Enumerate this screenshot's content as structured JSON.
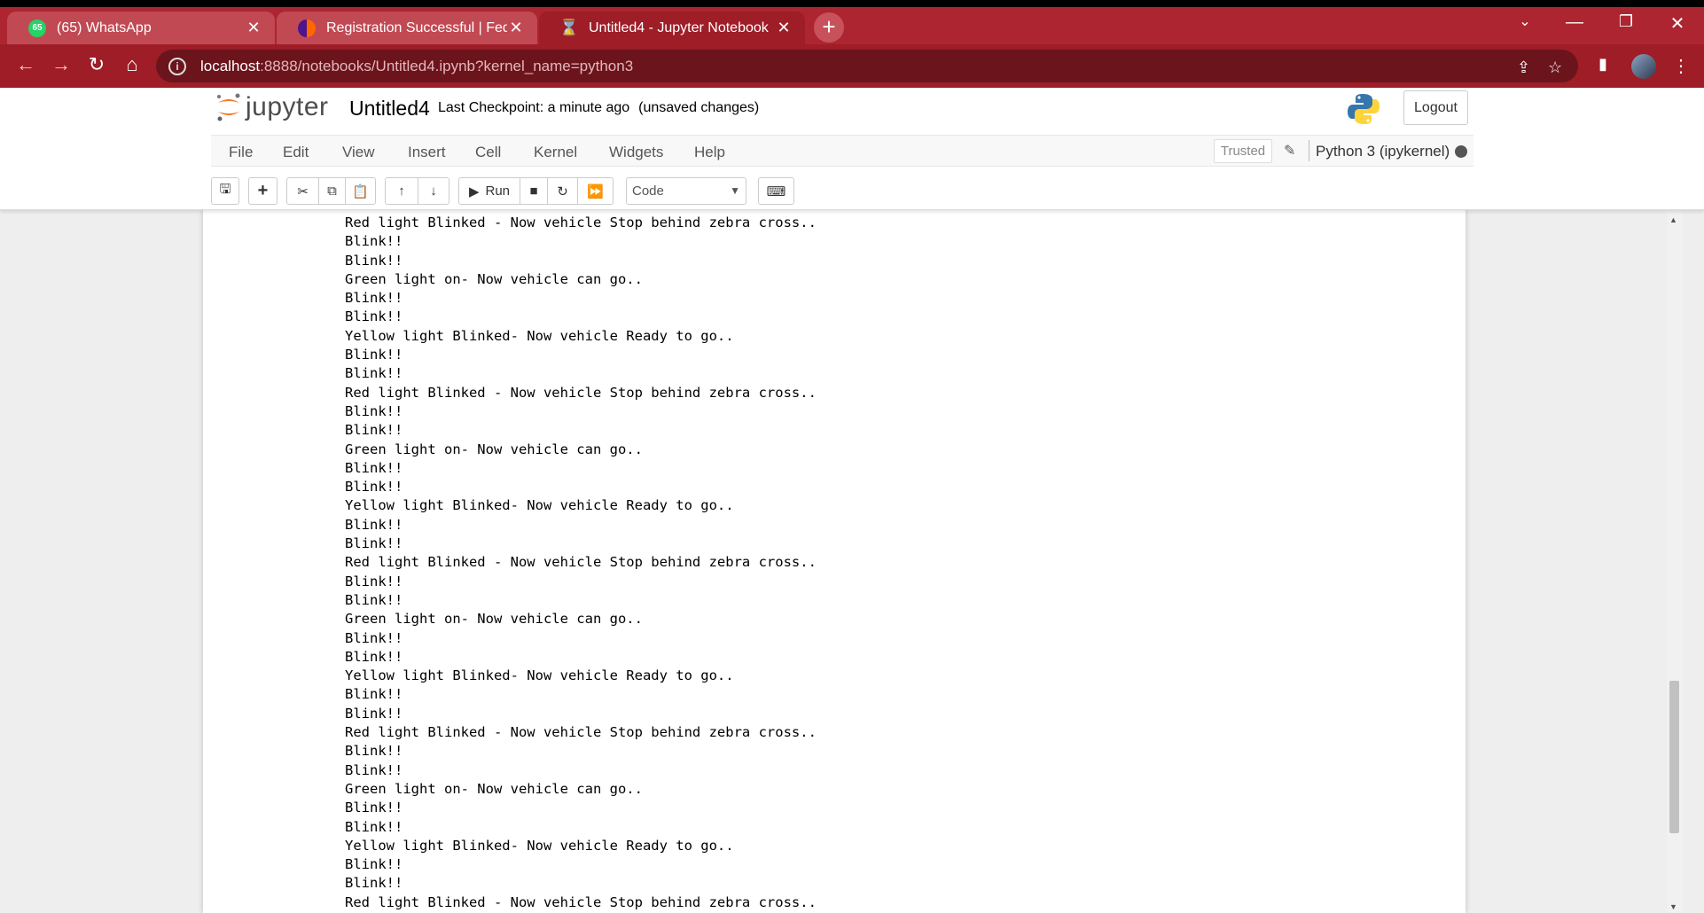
{
  "browser": {
    "tabs": [
      {
        "title": "(65) WhatsApp",
        "badge": "65",
        "favicon": "whatsapp-icon",
        "color": "#25d366",
        "active": false
      },
      {
        "title": "Registration Successful | FedEx In",
        "favicon": "fedex-icon",
        "color": "#4d148c",
        "active": false
      },
      {
        "title": "Untitled4 - Jupyter Notebook",
        "favicon": "hourglass-icon",
        "color": "#f37726",
        "active": true
      }
    ],
    "new_tab": "+",
    "url_host": "localhost",
    "url_path": ":8888/notebooks/Untitled4.ipynb?kernel_name=python3",
    "theme_color": "#ad2530"
  },
  "jupyter": {
    "logo_text": "jupyter",
    "notebook_title": "Untitled4",
    "checkpoint": "Last Checkpoint: a minute ago",
    "unsaved": "(unsaved changes)",
    "logout": "Logout",
    "menu": [
      "File",
      "Edit",
      "View",
      "Insert",
      "Cell",
      "Kernel",
      "Widgets",
      "Help"
    ],
    "trusted": "Trusted",
    "kernel": "Python 3 (ipykernel)",
    "run_label": "Run",
    "cell_type": "Code"
  },
  "output_lines": [
    "Red light Blinked - Now vehicle Stop behind zebra cross..",
    "Blink!!",
    "Blink!!",
    "Green light on- Now vehicle can go..",
    "Blink!!",
    "Blink!!",
    "Yellow light Blinked- Now vehicle Ready to go..",
    "Blink!!",
    "Blink!!",
    "Red light Blinked - Now vehicle Stop behind zebra cross..",
    "Blink!!",
    "Blink!!",
    "Green light on- Now vehicle can go..",
    "Blink!!",
    "Blink!!",
    "Yellow light Blinked- Now vehicle Ready to go..",
    "Blink!!",
    "Blink!!",
    "Red light Blinked - Now vehicle Stop behind zebra cross..",
    "Blink!!",
    "Blink!!",
    "Green light on- Now vehicle can go..",
    "Blink!!",
    "Blink!!",
    "Yellow light Blinked- Now vehicle Ready to go..",
    "Blink!!",
    "Blink!!",
    "Red light Blinked - Now vehicle Stop behind zebra cross..",
    "Blink!!",
    "Blink!!",
    "Green light on- Now vehicle can go..",
    "Blink!!",
    "Blink!!",
    "Yellow light Blinked- Now vehicle Ready to go..",
    "Blink!!",
    "Blink!!",
    "Red light Blinked - Now vehicle Stop behind zebra cross.."
  ]
}
